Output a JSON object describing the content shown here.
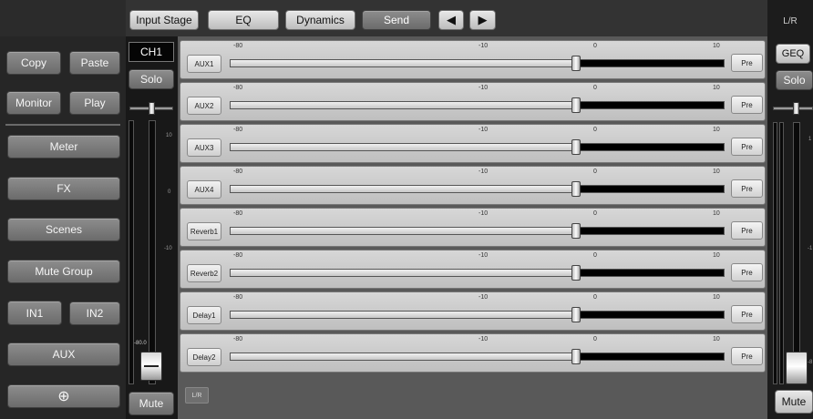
{
  "top_tabs": [
    {
      "label": "Input Stage",
      "active": false
    },
    {
      "label": "EQ",
      "active": false
    },
    {
      "label": "Dynamics",
      "active": false
    },
    {
      "label": "Send",
      "active": true
    }
  ],
  "nav_icons": [
    "prev-arrow-icon",
    "next-arrow-icon"
  ],
  "nav_glyphs": {
    "prev": "◀",
    "next": "▶"
  },
  "left_panel": {
    "copy": "Copy",
    "paste": "Paste",
    "monitor": "Monitor",
    "play": "Play",
    "meter": "Meter",
    "fx": "FX",
    "scenes": "Scenes",
    "mute_group": "Mute Group",
    "in1": "IN1",
    "in2": "IN2",
    "aux": "AUX",
    "target_icon": "crosshair-icon",
    "target_glyph": "⊕"
  },
  "channel": {
    "name": "CH1",
    "solo": "Solo",
    "mute": "Mute",
    "scale": [
      "10",
      "0",
      "-10",
      "-80.0"
    ],
    "fader_db": "-80.0",
    "fader_level": 0.07
  },
  "sends": {
    "scale_labels": [
      "-80",
      "-10",
      "0",
      "10"
    ],
    "rows": [
      {
        "label": "AUX1",
        "pre": "Pre",
        "level": 0.7
      },
      {
        "label": "AUX2",
        "pre": "Pre",
        "level": 0.7
      },
      {
        "label": "AUX3",
        "pre": "Pre",
        "level": 0.7
      },
      {
        "label": "AUX4",
        "pre": "Pre",
        "level": 0.7
      },
      {
        "label": "Reverb1",
        "pre": "Pre",
        "level": 0.7
      },
      {
        "label": "Reverb2",
        "pre": "Pre",
        "level": 0.7
      },
      {
        "label": "Delay1",
        "pre": "Pre",
        "level": 0.7
      },
      {
        "label": "Delay2",
        "pre": "Pre",
        "level": 0.7
      }
    ],
    "lr_button": "L/R"
  },
  "lr_strip": {
    "title": "L/R",
    "geq": "GEQ",
    "solo": "Solo",
    "mute": "Mute",
    "scale": [
      "1",
      "-1",
      "-8"
    ]
  },
  "colors": {
    "panel_dark": "#262626",
    "send_bg": "#595959",
    "accent_light": "#e0e0e0"
  }
}
